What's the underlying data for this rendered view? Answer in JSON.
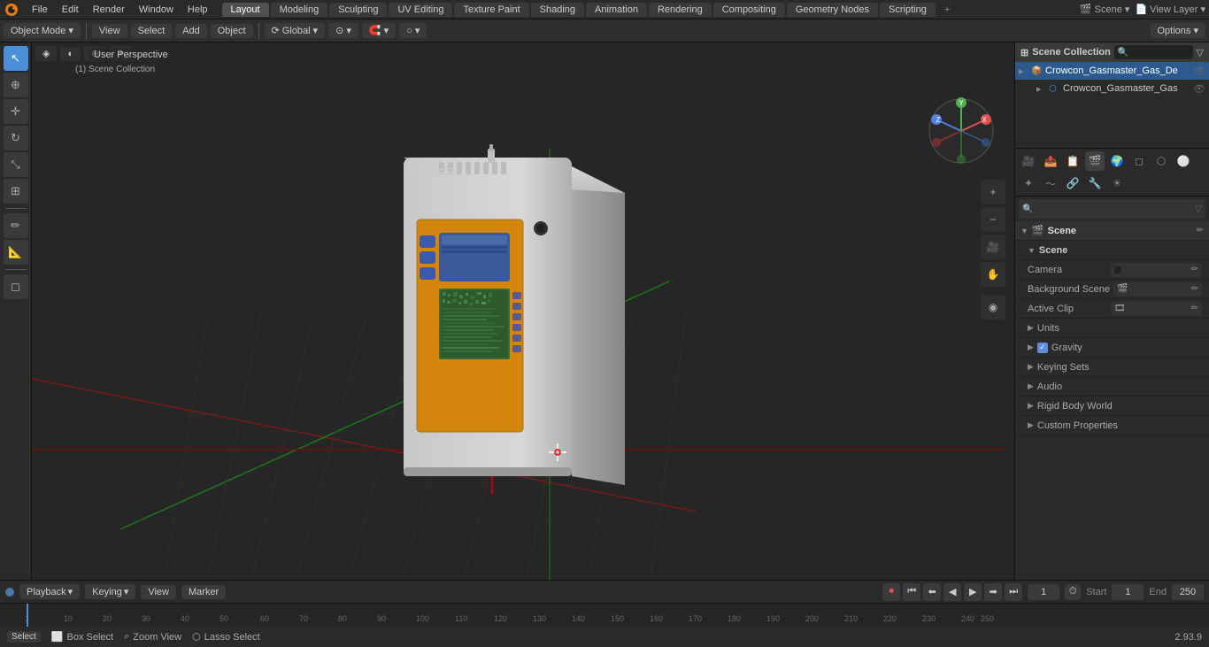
{
  "app": {
    "title": "Blender",
    "version": "2.93.9"
  },
  "topmenu": {
    "logo": "🔵",
    "items": [
      "File",
      "Edit",
      "Render",
      "Window",
      "Help"
    ]
  },
  "workspace_tabs": [
    "Layout",
    "Modeling",
    "Sculpting",
    "UV Editing",
    "Texture Paint",
    "Shading",
    "Animation",
    "Rendering",
    "Compositing",
    "Geometry Nodes",
    "Scripting"
  ],
  "active_workspace": "Layout",
  "toolbar2": {
    "mode": "Object Mode",
    "view": "View",
    "select": "Select",
    "add": "Add",
    "object": "Object",
    "transform_global": "Global",
    "options": "Options ▾"
  },
  "viewport": {
    "perspective_label": "User Perspective",
    "scene_label": "(1) Scene Collection"
  },
  "outliner": {
    "title": "Scene Collection",
    "search_placeholder": "🔍",
    "items": [
      {
        "name": "Crowcon_Gasmaster_Gas_De",
        "indent": 0,
        "expanded": true,
        "icon": "▷"
      },
      {
        "name": "Crowcon_Gasmaster_Gas",
        "indent": 1,
        "expanded": false,
        "icon": "▷"
      }
    ]
  },
  "properties": {
    "active_tab": "scene",
    "tabs": [
      "render",
      "output",
      "view_layer",
      "scene",
      "world",
      "object",
      "mesh",
      "material",
      "particles",
      "physics",
      "constraints",
      "modifiers",
      "shader"
    ],
    "scene_header": "Scene",
    "camera_label": "Camera",
    "camera_value": "",
    "background_scene_label": "Background Scene",
    "active_clip_label": "Active Clip",
    "sections": {
      "units": "Units",
      "gravity": "Gravity",
      "gravity_checked": true,
      "keying_sets": "Keying Sets",
      "audio": "Audio",
      "rigid_body_world": "Rigid Body World",
      "custom_properties": "Custom Properties"
    }
  },
  "timeline": {
    "playback_label": "Playback",
    "keying_label": "Keying",
    "view_label": "View",
    "marker_label": "Marker",
    "current_frame": "1",
    "start_label": "Start",
    "start_value": "1",
    "end_label": "End",
    "end_value": "250"
  },
  "statusbar": {
    "select_key": "Select",
    "box_select_icon": "⬜",
    "box_select_label": "Box Select",
    "zoom_icon": "🔍",
    "zoom_label": "Zoom View",
    "lasso_icon": "⬡",
    "lasso_label": "Lasso Select",
    "version": "2.93.9"
  }
}
